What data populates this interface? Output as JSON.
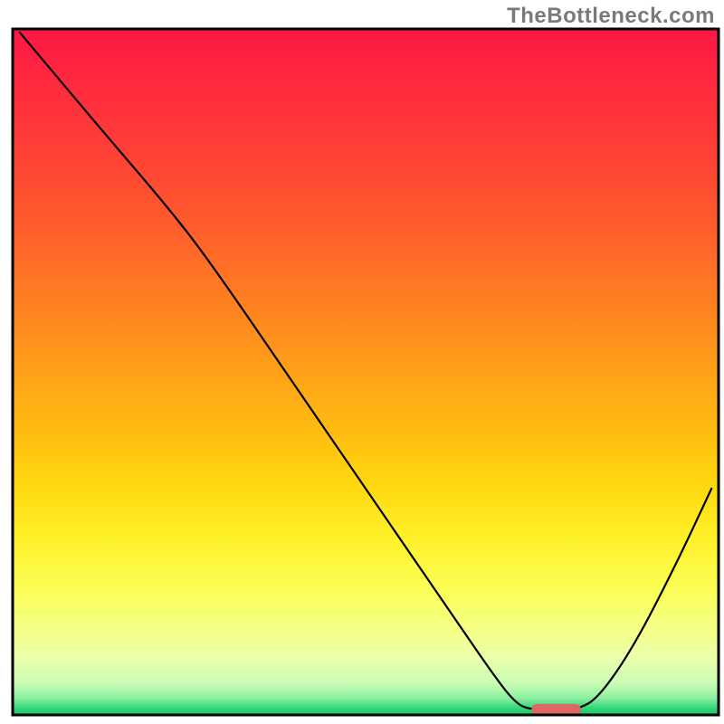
{
  "watermark": "TheBottleneck.com",
  "chart_data": {
    "type": "line",
    "title": "",
    "xlabel": "",
    "ylabel": "",
    "xlim": [
      0,
      100
    ],
    "ylim": [
      0,
      100
    ],
    "background_gradient": {
      "stops": [
        {
          "offset": 0.0,
          "color": "#ff1744"
        },
        {
          "offset": 0.08,
          "color": "#ff2a3f"
        },
        {
          "offset": 0.18,
          "color": "#ff4035"
        },
        {
          "offset": 0.28,
          "color": "#ff5a2d"
        },
        {
          "offset": 0.38,
          "color": "#ff7a22"
        },
        {
          "offset": 0.48,
          "color": "#ff9a1a"
        },
        {
          "offset": 0.58,
          "color": "#ffba12"
        },
        {
          "offset": 0.66,
          "color": "#ffd60e"
        },
        {
          "offset": 0.74,
          "color": "#fff028"
        },
        {
          "offset": 0.82,
          "color": "#fbff58"
        },
        {
          "offset": 0.88,
          "color": "#f4ff8a"
        },
        {
          "offset": 0.92,
          "color": "#e9ffae"
        },
        {
          "offset": 0.955,
          "color": "#c8fcb4"
        },
        {
          "offset": 0.975,
          "color": "#8ef0a0"
        },
        {
          "offset": 0.99,
          "color": "#34d67a"
        },
        {
          "offset": 1.0,
          "color": "#18c465"
        }
      ]
    },
    "series": [
      {
        "name": "bottleneck-curve",
        "color": "#000000",
        "width": 2.2,
        "points": [
          {
            "x": 1.0,
            "y": 99.5
          },
          {
            "x": 12.0,
            "y": 86.0
          },
          {
            "x": 22.0,
            "y": 74.0
          },
          {
            "x": 28.0,
            "y": 66.0
          },
          {
            "x": 40.0,
            "y": 48.0
          },
          {
            "x": 52.0,
            "y": 30.0
          },
          {
            "x": 62.0,
            "y": 15.0
          },
          {
            "x": 68.0,
            "y": 6.0
          },
          {
            "x": 71.0,
            "y": 2.0
          },
          {
            "x": 73.0,
            "y": 0.8
          },
          {
            "x": 77.0,
            "y": 0.8
          },
          {
            "x": 80.0,
            "y": 0.8
          },
          {
            "x": 83.0,
            "y": 2.5
          },
          {
            "x": 88.0,
            "y": 10.0
          },
          {
            "x": 94.0,
            "y": 22.0
          },
          {
            "x": 99.0,
            "y": 33.0
          }
        ]
      }
    ],
    "marker": {
      "name": "optimal-range",
      "color": "#e06666",
      "x_start": 73.5,
      "x_end": 80.5,
      "y": 0.8,
      "thickness": 12
    },
    "frame_color": "#000000",
    "frame_width": 3
  }
}
